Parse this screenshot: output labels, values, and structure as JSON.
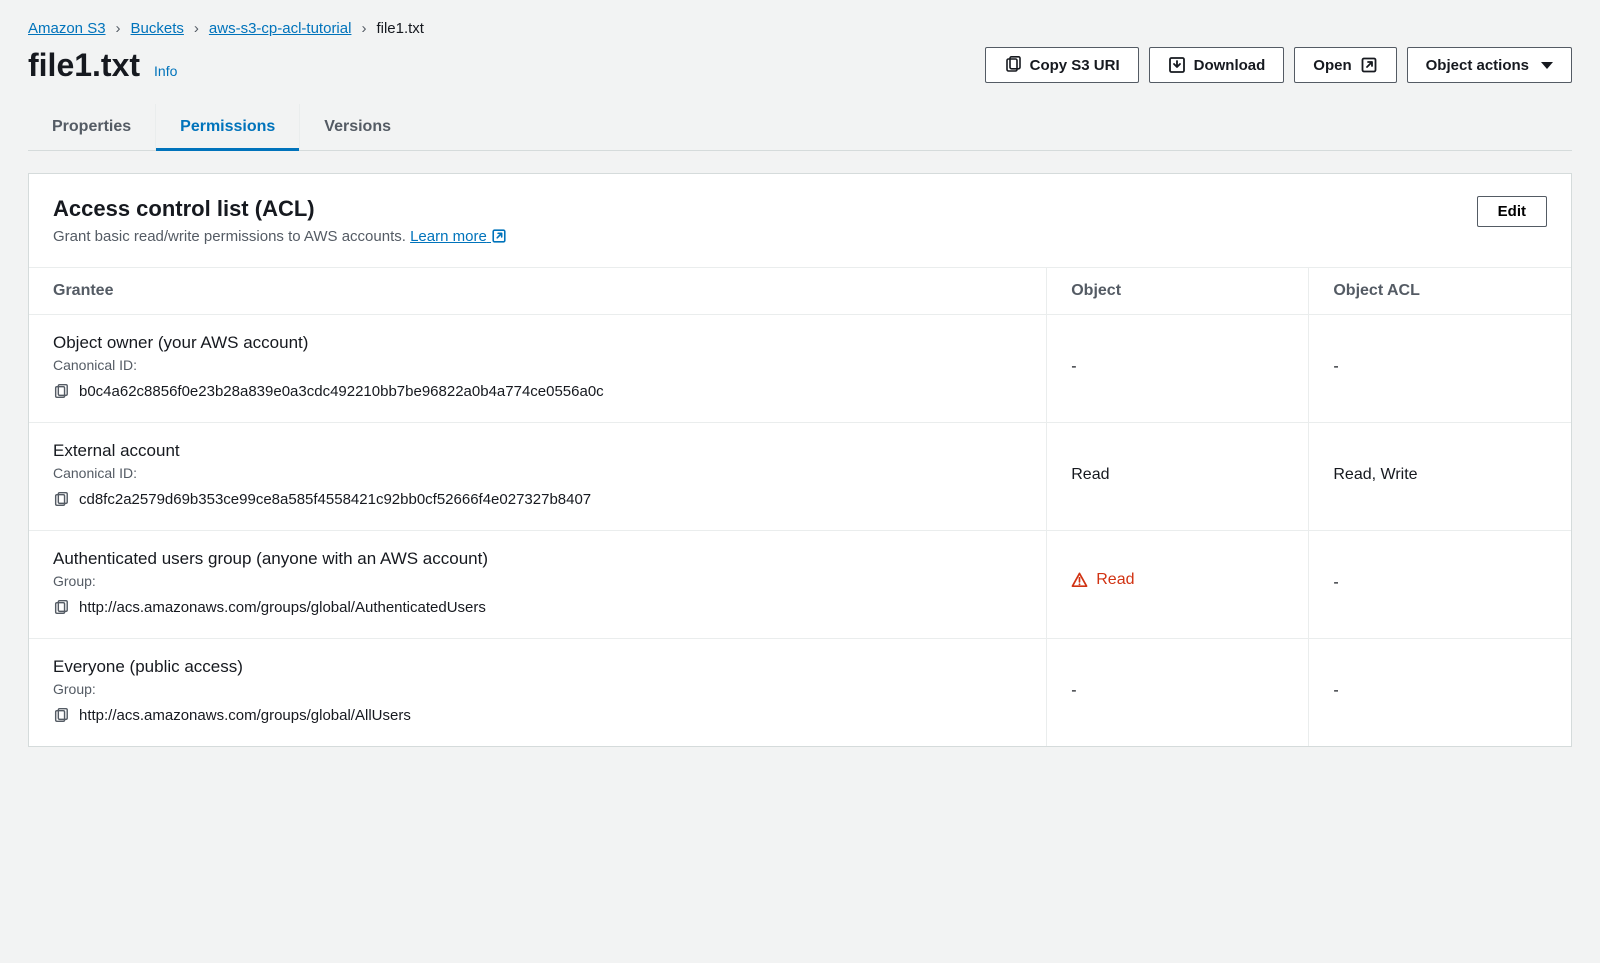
{
  "breadcrumb": {
    "items": [
      {
        "label": "Amazon S3",
        "link": true
      },
      {
        "label": "Buckets",
        "link": true
      },
      {
        "label": "aws-s3-cp-acl-tutorial",
        "link": true
      },
      {
        "label": "file1.txt",
        "link": false
      }
    ]
  },
  "header": {
    "title": "file1.txt",
    "info_label": "Info",
    "buttons": {
      "copy_uri": "Copy S3 URI",
      "download": "Download",
      "open": "Open",
      "object_actions": "Object actions"
    }
  },
  "tabs": {
    "properties": "Properties",
    "permissions": "Permissions",
    "versions": "Versions"
  },
  "panel": {
    "title": "Access control list (ACL)",
    "description": "Grant basic read/write permissions to AWS accounts. ",
    "learn_more": "Learn more",
    "edit_label": "Edit",
    "columns": {
      "grantee": "Grantee",
      "object": "Object",
      "object_acl": "Object ACL"
    },
    "rows": [
      {
        "title": "Object owner (your AWS account)",
        "id_label": "Canonical ID:",
        "id_value": "b0c4a62c8856f0e23b28a839e0a3cdc492210bb7be96822a0b4a774ce0556a0c",
        "object": "-",
        "object_acl": "-",
        "object_warn": false
      },
      {
        "title": "External account",
        "id_label": "Canonical ID:",
        "id_value": "cd8fc2a2579d69b353ce99ce8a585f4558421c92bb0cf52666f4e027327b8407",
        "object": "Read",
        "object_acl": "Read, Write",
        "object_warn": false
      },
      {
        "title": "Authenticated users group (anyone with an AWS account)",
        "id_label": "Group:",
        "id_value": "http://acs.amazonaws.com/groups/global/AuthenticatedUsers",
        "object": "Read",
        "object_acl": "-",
        "object_warn": true
      },
      {
        "title": "Everyone (public access)",
        "id_label": "Group:",
        "id_value": "http://acs.amazonaws.com/groups/global/AllUsers",
        "object": "-",
        "object_acl": "-",
        "object_warn": false
      }
    ]
  }
}
